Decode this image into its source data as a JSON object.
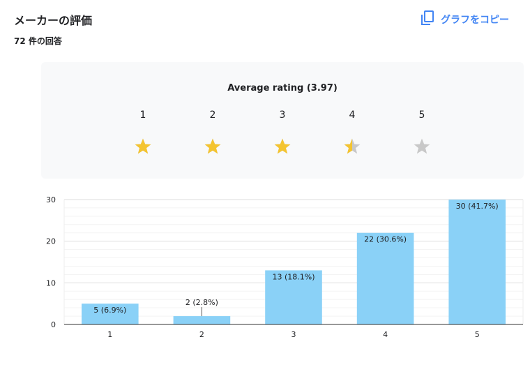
{
  "header": {
    "title": "メーカーの評価",
    "response_count": "72 件の回答",
    "copy_button_label": "グラフをコピー",
    "copy_icon": "copy-icon"
  },
  "rating_card": {
    "average_label": "Average rating (3.97)",
    "average_value": 3.97,
    "star_labels": [
      "1",
      "2",
      "3",
      "4",
      "5"
    ],
    "star_fill": [
      1,
      1,
      1,
      0.5,
      0
    ],
    "star_color": "#f4c430",
    "star_empty_color": "#c8c8c8"
  },
  "colors": {
    "bar": "#8ad1f7",
    "accent": "#4285f4",
    "card_bg": "#f8f9fa"
  },
  "chart_data": {
    "type": "bar",
    "categories": [
      "1",
      "2",
      "3",
      "4",
      "5"
    ],
    "values": [
      5,
      2,
      13,
      22,
      30
    ],
    "data_labels": [
      "5 (6.9%)",
      "2 (2.8%)",
      "13 (18.1%)",
      "22 (30.6%)",
      "30 (41.7%)"
    ],
    "y_ticks": [
      "0",
      "10",
      "20",
      "30"
    ],
    "ylim": [
      0,
      30
    ],
    "grid": true,
    "title": "",
    "xlabel": "",
    "ylabel": ""
  }
}
